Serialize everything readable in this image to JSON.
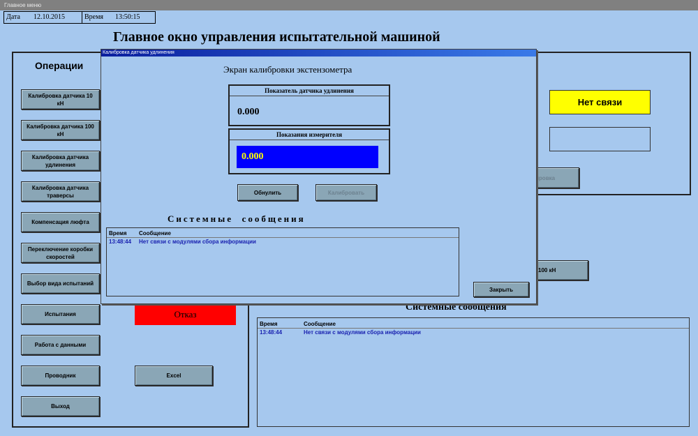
{
  "window": {
    "title": "Главное меню"
  },
  "header": {
    "date_label": "Дата",
    "date_value": "12.10.2015",
    "time_label": "Время",
    "time_value": "13:50:15"
  },
  "main_title": "Главное окно управления испытательной машиной",
  "operations": {
    "title": "Операции",
    "buttons": [
      "Калибровка датчика 10 кН",
      "Калибровка датчика 100 кН",
      "Калибровка датчика удлинения",
      "Калибровка датчика траверсы",
      "Компенсация люфта",
      "Переключение коробки скоростей",
      "Выбор вида испытаний",
      "Испытания",
      "Работа с данными",
      "Проводник",
      "Выход"
    ]
  },
  "status": {
    "connection": "Нет связи",
    "failure": "Отказ",
    "connection_color": "#ffff00",
    "failure_color": "#ff0000"
  },
  "excel_button": "Excel",
  "hidden_fragments": {
    "calibration_button_partial": "ировка",
    "sensor_button_partial": "100 кН"
  },
  "system_messages": {
    "title": "Системные сообщения",
    "columns": [
      "Время",
      "Сообщение"
    ],
    "rows": [
      {
        "time": "13:48:44",
        "message": "Нет связи с модулями сбора информации"
      }
    ]
  },
  "dialog": {
    "title": "Калибровка датчика удлинения",
    "heading": "Экран калибровки экстензометра",
    "sensor_group_title": "Показатель датчика удлинения",
    "sensor_value": "0.000",
    "meter_group_title": "Показания измерителя",
    "meter_value": "0.000",
    "meter_color": "#0000ff",
    "reset_button": "Обнулить",
    "calibrate_button": "Калибровать",
    "close_button": "Закрыть",
    "messages_title": "Системные  сообщения",
    "columns": [
      "Время",
      "Сообщение"
    ],
    "rows": [
      {
        "time": "13:48:44",
        "message": "Нет связи с модулями сбора информации"
      }
    ]
  }
}
